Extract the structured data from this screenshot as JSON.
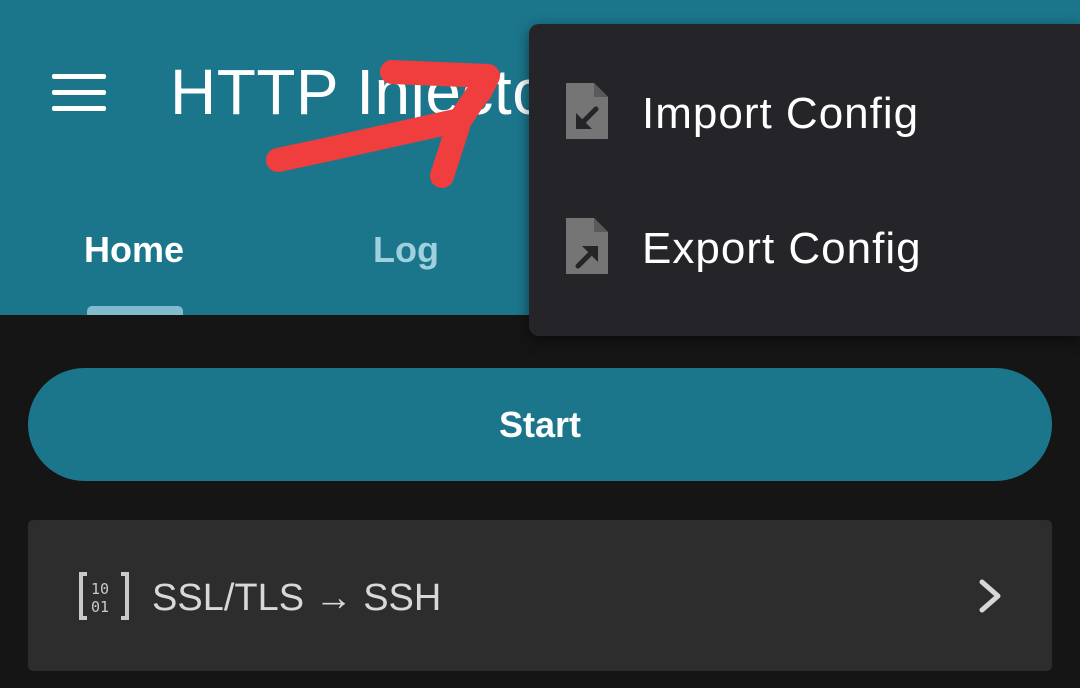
{
  "toolbar": {
    "menu_icon": "hamburger-menu-icon",
    "title": "HTTP Injector"
  },
  "tabs": [
    {
      "label": "Home",
      "selected": true
    },
    {
      "label": "Log",
      "selected": false
    }
  ],
  "main": {
    "start_label": "Start",
    "tunnel": {
      "icon": "binary-code-icon",
      "label": "SSL/TLS → SSH",
      "chevron": "chevron-right-icon"
    }
  },
  "overflow_menu": {
    "items": [
      {
        "label": "Import Config",
        "icon": "file-import-icon"
      },
      {
        "label": "Export Config",
        "icon": "file-export-icon"
      }
    ]
  },
  "colors": {
    "appbar": "#1b768c",
    "background": "#151515",
    "menu": "#252429",
    "card": "#2d2d2d",
    "annotation": "#f03d3d"
  }
}
